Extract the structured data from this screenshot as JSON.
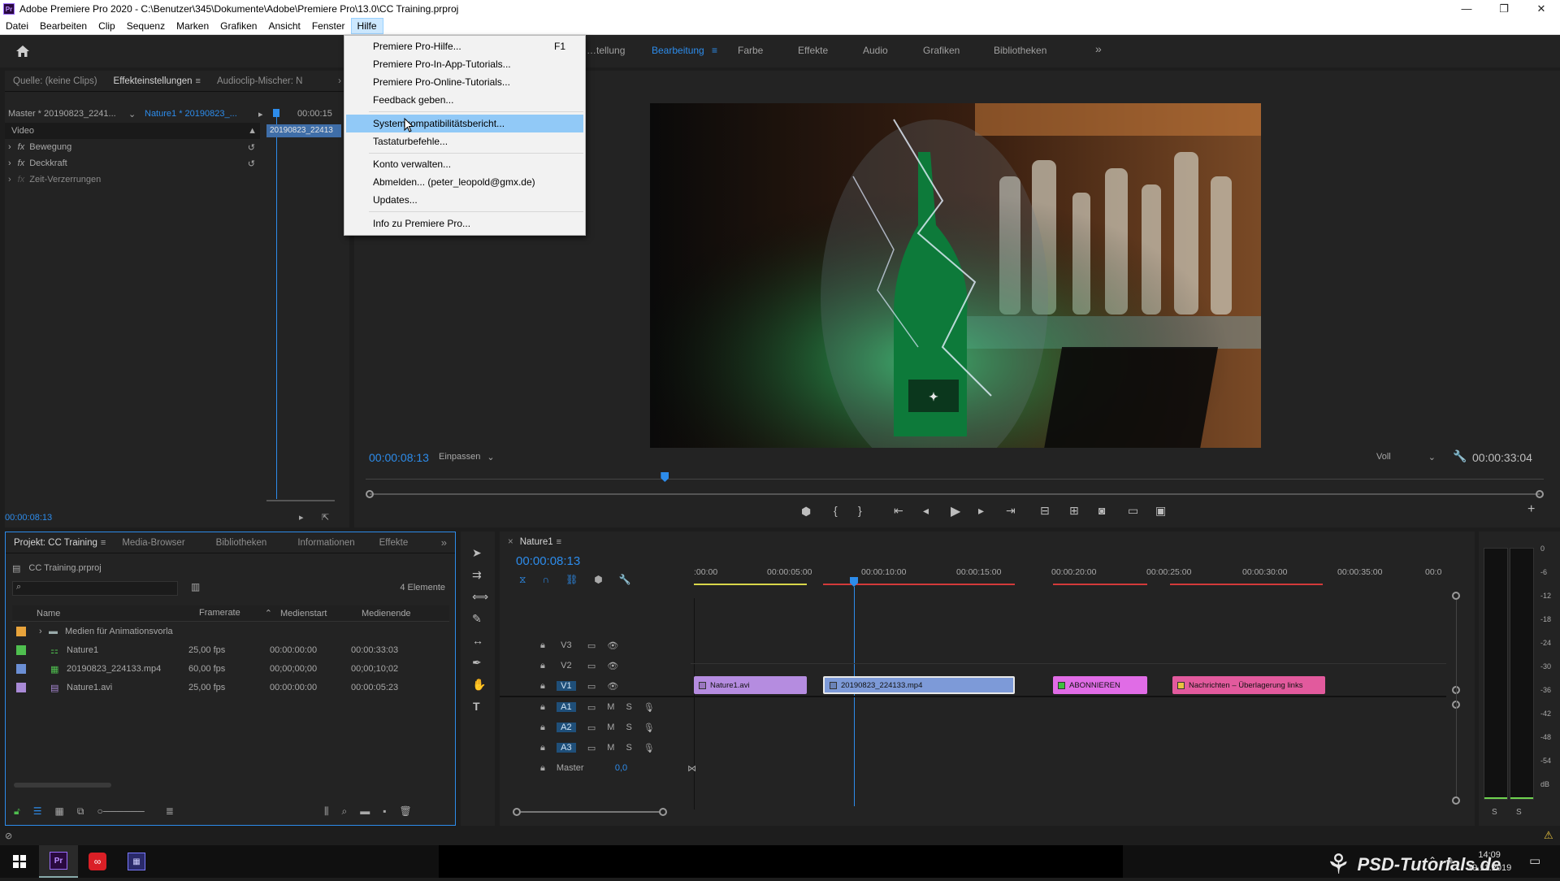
{
  "window": {
    "title": "Adobe Premiere Pro 2020 - C:\\Benutzer\\345\\Dokumente\\Adobe\\Premiere Pro\\13.0\\CC Training.prproj",
    "app_icon": "Pr",
    "controls": [
      "—",
      "❐",
      "✕"
    ]
  },
  "menubar": {
    "items": [
      "Datei",
      "Bearbeiten",
      "Clip",
      "Sequenz",
      "Marken",
      "Grafiken",
      "Ansicht",
      "Fenster",
      "Hilfe"
    ],
    "active": "Hilfe"
  },
  "workspaces": {
    "items": [
      "…tellung",
      "Bearbeitung",
      "Farbe",
      "Effekte",
      "Audio",
      "Grafiken",
      "Bibliotheken"
    ],
    "active": "Bearbeitung",
    "more": "»"
  },
  "help_menu": {
    "items": [
      {
        "label": "Premiere Pro-Hilfe...",
        "shortcut": "F1"
      },
      {
        "label": "Premiere Pro-In-App-Tutorials...",
        "shortcut": ""
      },
      {
        "label": "Premiere Pro-Online-Tutorials...",
        "shortcut": ""
      },
      {
        "label": "Feedback geben...",
        "shortcut": ""
      },
      {
        "label": "Systemkompatibilitätsbericht...",
        "shortcut": "",
        "highlighted": true
      },
      {
        "label": "Tastaturbefehle...",
        "shortcut": ""
      },
      {
        "label": "Konto verwalten...",
        "shortcut": ""
      },
      {
        "label": "Abmelden... (peter_leopold@gmx.de)",
        "shortcut": ""
      },
      {
        "label": "Updates...",
        "shortcut": ""
      },
      {
        "label": "Info zu Premiere Pro...",
        "shortcut": ""
      }
    ]
  },
  "source_panel": {
    "tabs": [
      "Quelle: (keine Clips)",
      "Effekteinstellungen",
      "Audioclip-Mischer: N"
    ],
    "active_tab": "Effekteinstellungen",
    "master_label": "Master * 20190823_2241...",
    "clip_label": "Nature1 * 20190823_...",
    "mini_timecode": "00:00:15",
    "mini_clip": "20190823_22413",
    "video_header": "Video",
    "effects": [
      "Bewegung",
      "Deckkraft",
      "Zeit-Verzerrungen"
    ],
    "fx_label": "fx",
    "timecode": "00:00:08:13"
  },
  "program_monitor": {
    "timecode": "00:00:08:13",
    "fit": "Einpassen",
    "quality": "Voll",
    "duration": "00:00:33:04",
    "playhead_fraction": 0.254,
    "video_frame": "Green glowing Heineken bottle inside a glass cloche with a plasma-like lightning effect, shelves of liquor bottles in the background"
  },
  "project_panel": {
    "tabs": [
      "Projekt: CC Training",
      "Media-Browser",
      "Bibliotheken",
      "Informationen",
      "Effekte"
    ],
    "active_tab": "Projekt: CC Training",
    "project_file": "CC Training.prproj",
    "count": "4 Elemente",
    "columns": [
      "Name",
      "Framerate",
      "Medienstart",
      "Medienende"
    ],
    "rows": [
      {
        "color": "#e8a33b",
        "name": "Medien für Animationsvorla",
        "fps": "",
        "start": "",
        "end": ""
      },
      {
        "color": "#4fbf4f",
        "name": "Nature1",
        "fps": "25,00 fps",
        "start": "00:00:00:00",
        "end": "00:00:33:03"
      },
      {
        "color": "#6b8fd4",
        "name": "20190823_224133.mp4",
        "fps": "60,00 fps",
        "start": "00;00;00;00",
        "end": "00;00;10;02"
      },
      {
        "color": "#a98ad6",
        "name": "Nature1.avi",
        "fps": "25,00 fps",
        "start": "00:00:00:00",
        "end": "00:00:05:23"
      }
    ]
  },
  "timeline": {
    "sequence": "Nature1",
    "timecode": "00:00:08:13",
    "ruler": [
      ":00:00",
      "00:00:05:00",
      "00:00:10:00",
      "00:00:15:00",
      "00:00:20:00",
      "00:00:25:00",
      "00:00:30:00",
      "00:00:35:00",
      "00:0"
    ],
    "tracks": {
      "video": [
        "V3",
        "V2",
        "V1"
      ],
      "audio": [
        "A1",
        "A2",
        "A3"
      ]
    },
    "master_label": "Master",
    "master_value": "0,0",
    "mute": "M",
    "solo": "S",
    "clips": [
      {
        "label": "Nature1.avi",
        "color": "#b58ce0"
      },
      {
        "label": "20190823_224133.mp4",
        "color": "#7d9ad8"
      },
      {
        "label": "ABONNIEREN",
        "color": "#e06ce6"
      },
      {
        "label": "Nachrichten – Überlagerung links",
        "color": "#e25a9d"
      }
    ],
    "meter_labels": [
      "0",
      "-6",
      "-12",
      "-18",
      "-24",
      "-30",
      "-36",
      "-42",
      "-48",
      "-54",
      "dB"
    ],
    "meter_solo": [
      "S",
      "S"
    ]
  },
  "taskbar": {
    "time": "14:09",
    "date": "19.11.2019"
  },
  "watermark": "PSD-Tutorials.de"
}
